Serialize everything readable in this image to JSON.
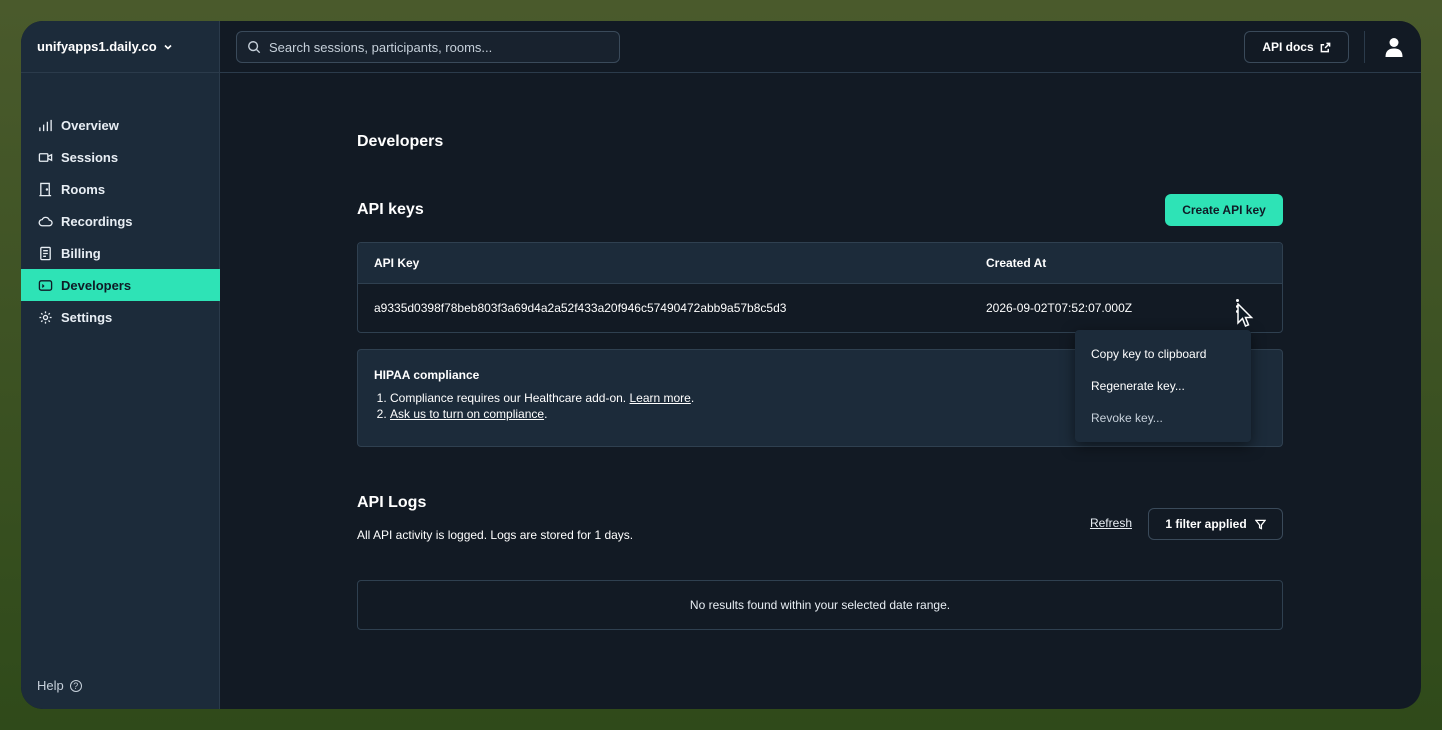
{
  "workspace": {
    "name": "unifyapps1.daily.co"
  },
  "sidebar": {
    "items": [
      {
        "label": "Overview",
        "icon": "bar-chart-icon",
        "active": false
      },
      {
        "label": "Sessions",
        "icon": "video-camera-icon",
        "active": false
      },
      {
        "label": "Rooms",
        "icon": "door-icon",
        "active": false
      },
      {
        "label": "Recordings",
        "icon": "cloud-icon",
        "active": false
      },
      {
        "label": "Billing",
        "icon": "receipt-icon",
        "active": false
      },
      {
        "label": "Developers",
        "icon": "terminal-icon",
        "active": true
      },
      {
        "label": "Settings",
        "icon": "gear-icon",
        "active": false
      }
    ],
    "help_label": "Help"
  },
  "topbar": {
    "search_placeholder": "Search sessions, participants, rooms...",
    "api_docs_label": "API docs"
  },
  "page": {
    "title": "Developers",
    "api_keys": {
      "title": "API keys",
      "create_label": "Create API key",
      "columns": [
        "API Key",
        "Created At"
      ],
      "rows": [
        {
          "key": "a9335d0398f78beb803f3a69d4a2a52f433a20f946c57490472abb9a57b8c5d3",
          "created_at": "2026-09-02T07:52:07.000Z"
        }
      ]
    },
    "context_menu": {
      "items": [
        "Copy key to clipboard",
        "Regenerate key...",
        "Revoke key..."
      ]
    },
    "hipaa": {
      "title": "HIPAA compliance",
      "line1_text": "Compliance requires our Healthcare add-on. ",
      "line1_link": "Learn more",
      "line2_link": "Ask us to turn on compliance",
      "period": "."
    },
    "api_logs": {
      "title": "API Logs",
      "refresh_label": "Refresh",
      "filter_label": "1 filter applied",
      "subtitle": "All API activity is logged. Logs are stored for 1 days.",
      "empty_message": "No results found within your selected date range."
    }
  },
  "colors": {
    "accent": "#2ee3b6",
    "background": "#121a24",
    "sidebar": "#1c2b3a"
  }
}
